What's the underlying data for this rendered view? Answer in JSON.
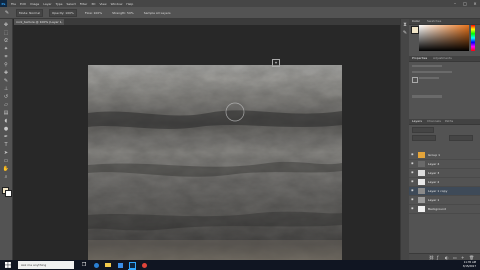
{
  "app": {
    "logo": "Ps",
    "menus": [
      "File",
      "Edit",
      "Image",
      "Layer",
      "Type",
      "Select",
      "Filter",
      "3D",
      "View",
      "Window",
      "Help"
    ]
  },
  "options_bar": {
    "items": [
      "Mode: Normal",
      "Opacity: 100%",
      "Flow: 100%",
      "Strength: 50%",
      "Sample All Layers"
    ]
  },
  "document": {
    "tab_label": "rock_texture @ 100% (Layer 1, RGB/8)"
  },
  "tools": [
    "move-icon",
    "marquee-icon",
    "lasso-icon",
    "quick-select-icon",
    "crop-icon",
    "eyedropper-icon",
    "healing-icon",
    "brush-icon",
    "stamp-icon",
    "history-brush-icon",
    "eraser-icon",
    "gradient-icon",
    "blur-icon",
    "dodge-icon",
    "pen-icon",
    "type-icon",
    "path-select-icon",
    "shape-icon",
    "hand-icon",
    "zoom-icon"
  ],
  "colors": {
    "foreground": "#f2e6c8",
    "background": "#ffffff",
    "picker_hue": "#e8741c",
    "accent_layer": "#e4a43a"
  },
  "panels": {
    "color_tab": "Color",
    "swatches_tab": "Swatches",
    "properties_tab": "Properties",
    "adjust_tab": "Adjustments",
    "layers_tab": "Layers",
    "channels_tab": "Channels",
    "paths_tab": "Paths"
  },
  "layers": [
    {
      "name": "Group 1",
      "thumb": "#e4a43a"
    },
    {
      "name": "Layer 4",
      "thumb": "#6a6a6a"
    },
    {
      "name": "Layer 3",
      "thumb": "#dcdcdc"
    },
    {
      "name": "Layer 2",
      "thumb": "#e8e8e8"
    },
    {
      "name": "Layer 1 copy",
      "thumb": "#8a8a8a"
    },
    {
      "name": "Layer 1",
      "thumb": "#9a9a9a"
    },
    {
      "name": "Background",
      "thumb": "#f0f0f0"
    }
  ],
  "taskbar": {
    "search_placeholder": "Ask me anything",
    "time": "11:35 AM",
    "date": "3/15/2017"
  }
}
